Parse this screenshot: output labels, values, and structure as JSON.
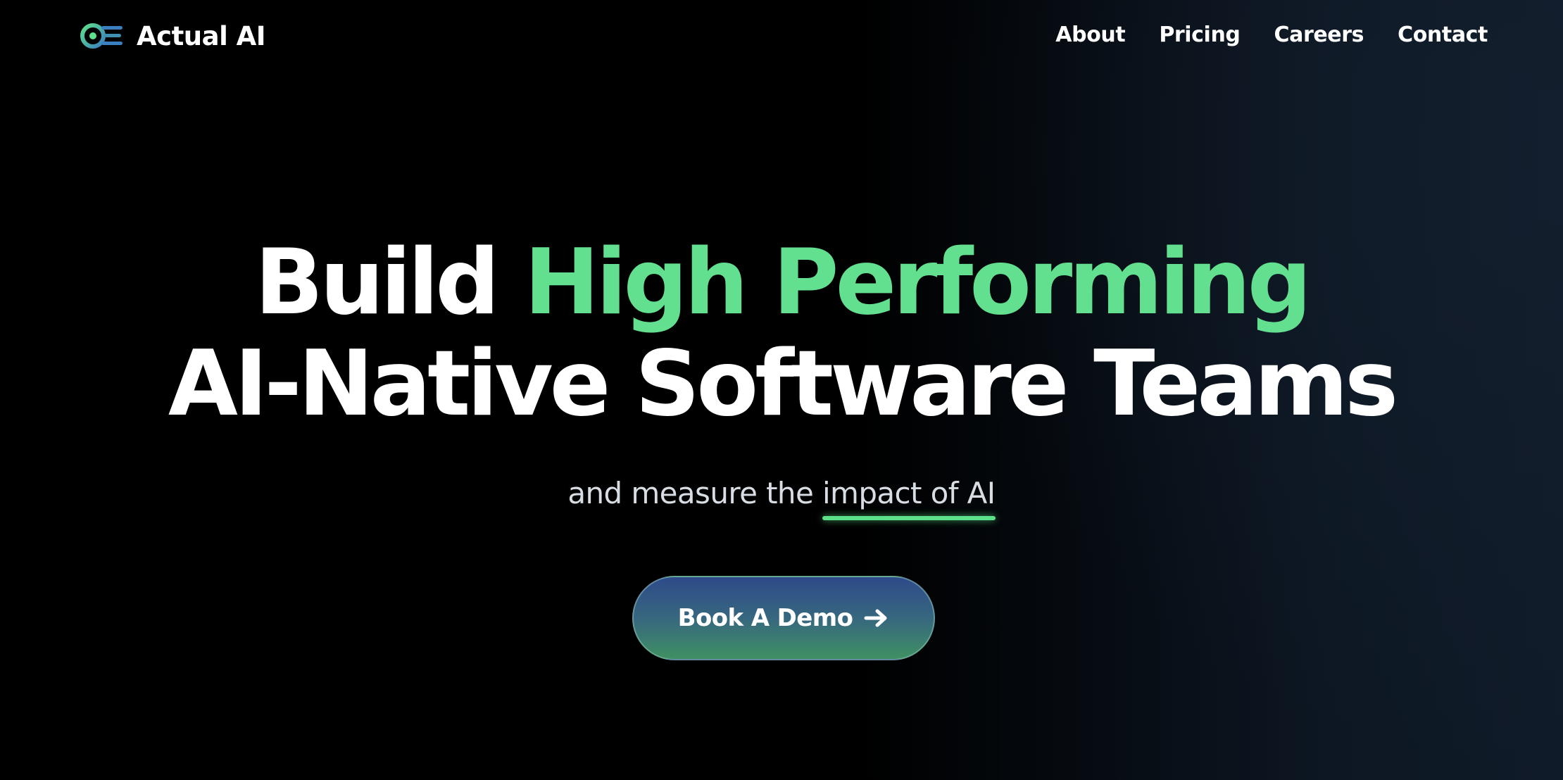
{
  "brand": {
    "name": "Actual AI",
    "logo_icon": "eye-speed-icon",
    "colors": {
      "accent_green": "#62df8f",
      "accent_blue": "#3a7fbf"
    }
  },
  "nav": {
    "items": [
      {
        "label": "About"
      },
      {
        "label": "Pricing"
      },
      {
        "label": "Careers"
      },
      {
        "label": "Contact"
      }
    ]
  },
  "hero": {
    "headline_line1_prefix": "Build ",
    "headline_line1_accent": "High Performing",
    "headline_line2": "AI-Native Software Teams",
    "subtitle_prefix": "and measure the ",
    "subtitle_highlight": "impact of AI",
    "cta_label": "Book A Demo",
    "cta_icon": "arrow-right-icon"
  },
  "colors": {
    "background": "#000000",
    "text": "#ffffff",
    "accent": "#62df8f",
    "cta_top": "#2e4a8a",
    "cta_bottom": "#3f9063"
  }
}
